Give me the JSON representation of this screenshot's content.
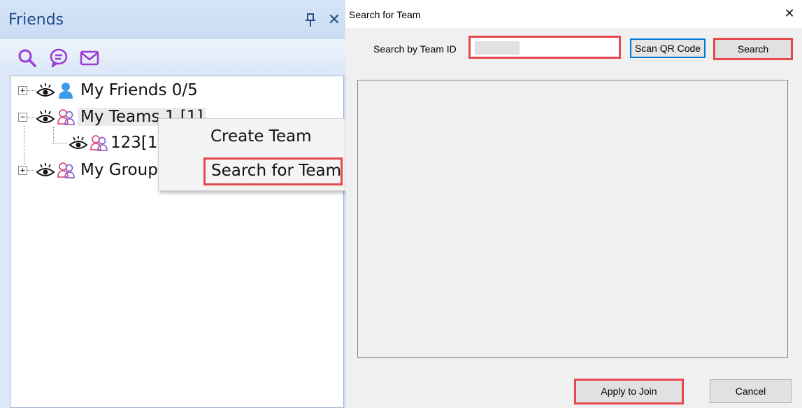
{
  "friends_panel": {
    "title": "Friends",
    "pin_glyph": "⊥",
    "close_glyph": "✕",
    "toolbar_icons": [
      "search-icon",
      "chat-icon",
      "mail-icon"
    ],
    "tree": {
      "friends": {
        "label": "My Friends 0/5",
        "expander": "+"
      },
      "teams": {
        "label": "My Teams 1 [1]",
        "expander": "−"
      },
      "team_item": {
        "label": "123[1]"
      },
      "groups": {
        "label": "My Groups",
        "expander": "+"
      }
    },
    "context_menu": {
      "create_team": "Create Team",
      "search_for_team": "Search for Team"
    }
  },
  "dialog": {
    "title": "Search for Team",
    "close_glyph": "✕",
    "team_id_label": "Search by Team ID",
    "team_id_value": "",
    "scan_qr_label": "Scan QR Code",
    "search_label": "Search",
    "apply_join_label": "Apply to Join",
    "cancel_label": "Cancel"
  },
  "colors": {
    "highlight_red": "#e5484d",
    "accent_blue": "#0078d7",
    "toolbar_purple": "#9b3bd1",
    "panel_title_blue": "#1f4d8c"
  }
}
